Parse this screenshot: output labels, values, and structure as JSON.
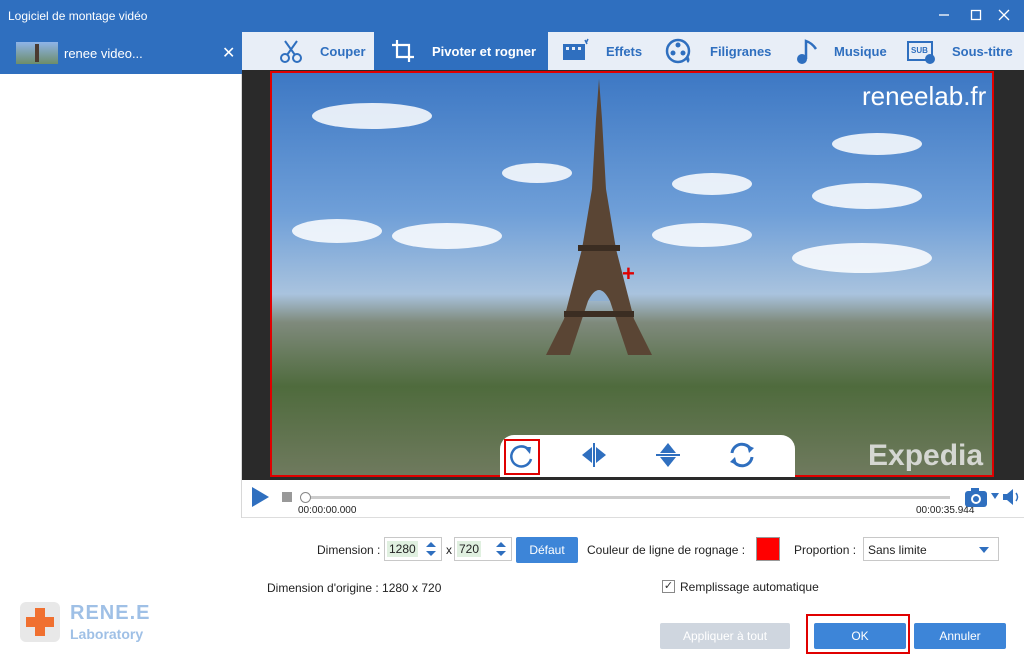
{
  "window": {
    "title": "Logiciel de montage vidéo"
  },
  "file_tab": {
    "name": "renee video...",
    "close_glyph": "✕"
  },
  "tabs": [
    {
      "label": "Couper",
      "icon": "scissors-icon"
    },
    {
      "label": "Pivoter et rogner",
      "icon": "crop-rotate-icon",
      "active": true
    },
    {
      "label": "Effets",
      "icon": "effects-film-icon"
    },
    {
      "label": "Filigranes",
      "icon": "watermark-reel-icon"
    },
    {
      "label": "Musique",
      "icon": "music-note-icon"
    },
    {
      "label": "Sous-titre",
      "icon": "subtitle-icon"
    }
  ],
  "preview": {
    "watermark_top": "reneelab.fr",
    "watermark_bottom": "Expedia"
  },
  "player": {
    "time_current": "00:00:00.000",
    "time_total": "00:00:35.944",
    "progress": 0
  },
  "controls": {
    "dimension_label": "Dimension :",
    "width": "1280",
    "x_sep": "x",
    "height": "720",
    "default_button": "Défaut",
    "crop_color_label": "Couleur de ligne de rognage :",
    "crop_color": "#ff0000",
    "proportion_label": "Proportion :",
    "proportion_value": "Sans limite",
    "original_dimension": "Dimension d'origine : 1280 x 720",
    "auto_fill_label": "Remplissage automatique",
    "auto_fill_checked": true
  },
  "buttons": {
    "apply_all": "Appliquer à tout",
    "ok": "OK",
    "cancel": "Annuler"
  },
  "logo": {
    "line1": "RENE.E",
    "line2": "Laboratory"
  },
  "colors": {
    "accent": "#2f6fbf",
    "highlight": "#e00000"
  }
}
